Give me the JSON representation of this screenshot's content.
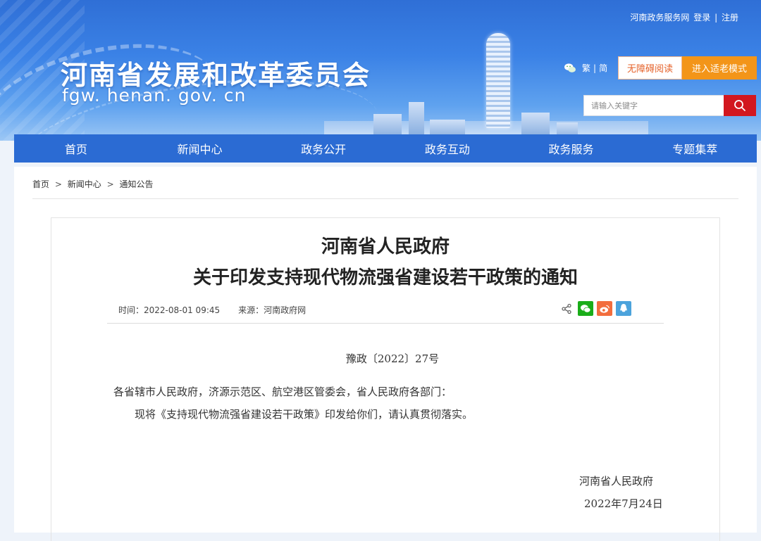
{
  "header": {
    "site_title": "河南省发展和改革委员会",
    "site_domain": "fgw. henan. gov. cn",
    "top_links": {
      "portal": "河南政务服务网",
      "login": "登录",
      "divider": "|",
      "register": "注册"
    },
    "lang": {
      "traditional": "繁",
      "divider": "|",
      "simplified": "简"
    },
    "accessibility_label": "无障碍阅读",
    "elder_mode_label": "进入适老模式",
    "search": {
      "placeholder": "请输入关键字"
    }
  },
  "nav": {
    "items": [
      {
        "label": "首页"
      },
      {
        "label": "新闻中心"
      },
      {
        "label": "政务公开"
      },
      {
        "label": "政务互动"
      },
      {
        "label": "政务服务"
      },
      {
        "label": "专题集萃"
      }
    ]
  },
  "breadcrumb": {
    "items": [
      "首页",
      "新闻中心",
      "通知公告"
    ],
    "separator": ">"
  },
  "article": {
    "title_line1": "河南省人民政府",
    "title_line2": "关于印发支持现代物流强省建设若干政策的通知",
    "time_label": "时间：2022-08-01 09:45",
    "source_label": "来源：河南政府网",
    "doc_number": "豫政〔2022〕27号",
    "addressee": "各省辖市人民政府，济源示范区、航空港区管委会，省人民政府各部门：",
    "body": "现将《支持现代物流强省建设若干政策》印发给你们，请认真贯彻落实。",
    "signature": "河南省人民政府",
    "date": "2022年7月24日"
  },
  "share": {
    "icons": [
      "share-icon",
      "wechat-icon",
      "weibo-icon",
      "qq-icon"
    ],
    "colors": {
      "wechat": "#1aad19",
      "weibo": "#f26d3d",
      "qq": "#4ca3dc"
    }
  },
  "colors": {
    "nav_bg": "#2b6bd3",
    "search_button": "#d2171f",
    "elder_button": "#f39519",
    "accessibility_text": "#e5622a"
  }
}
